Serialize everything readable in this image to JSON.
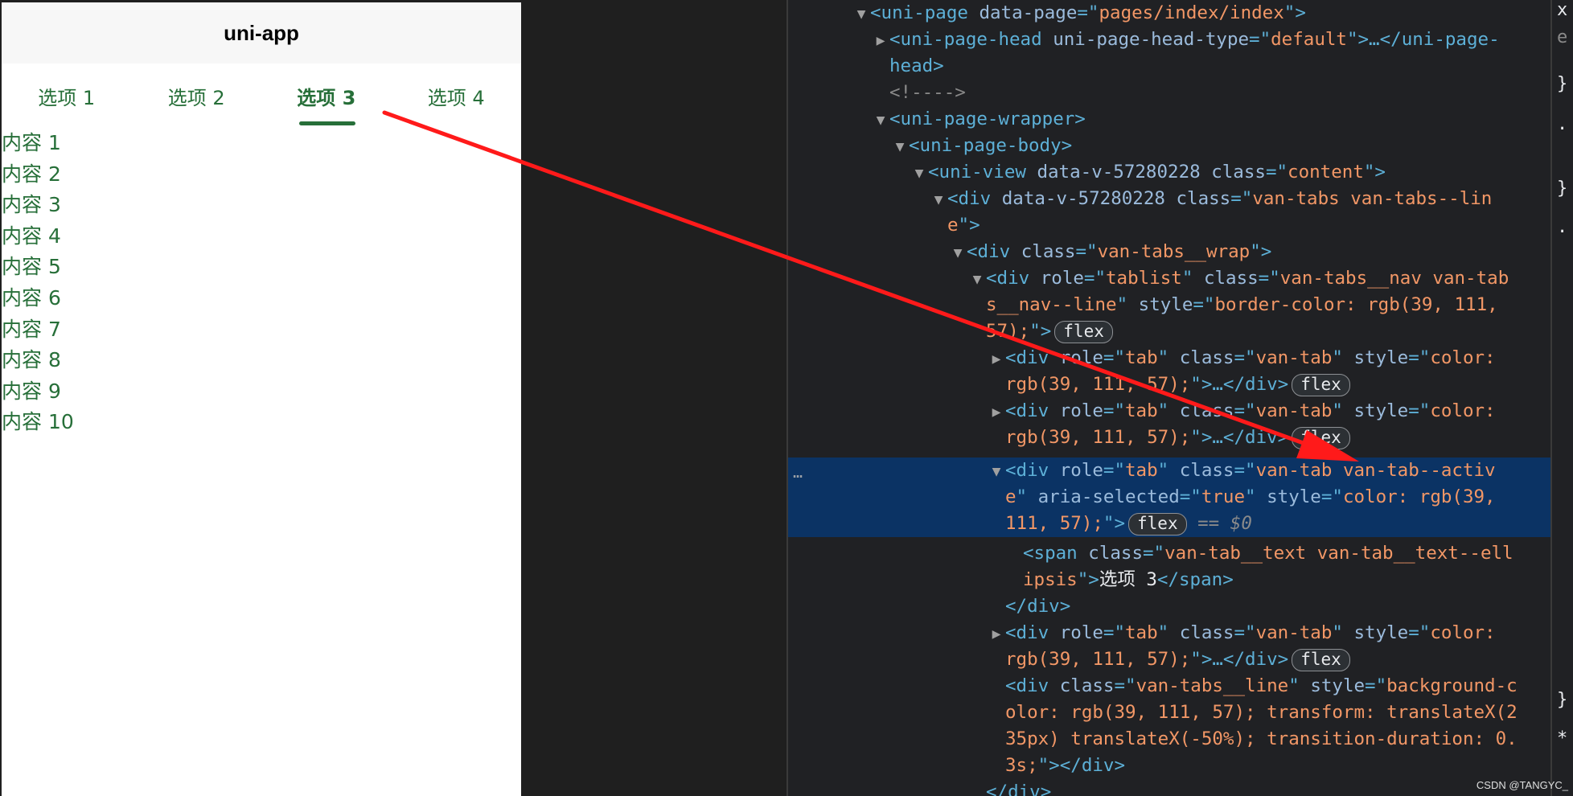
{
  "app": {
    "title": "uni-app"
  },
  "tabs": [
    {
      "label": "选项 1"
    },
    {
      "label": "选项 2"
    },
    {
      "label": "选项 3",
      "active": true
    },
    {
      "label": "选项 4"
    }
  ],
  "contents": [
    "内容 1",
    "内容 2",
    "内容 3",
    "内容 4",
    "内容 5",
    "内容 6",
    "内容 7",
    "内容 8",
    "内容 9",
    "内容 10"
  ],
  "colors": {
    "accent": "#276f39",
    "arrow": "#ff1a1a",
    "selection": "#0b3364"
  },
  "devtools": {
    "l1": {
      "tag_open": "<uni-page ",
      "attr": "data-page",
      "eq": "=\"",
      "val": "pages/index/index",
      "close": "\">"
    },
    "l2": {
      "tag_open": "<uni-page-head ",
      "attr": "uni-page-head-type",
      "eq": "=\"",
      "val": "default",
      "close": "\">…</uni-page-"
    },
    "l2b": {
      "text": "head>"
    },
    "l3": {
      "comment": "<!---->"
    },
    "l4": {
      "tag": "<uni-page-wrapper>"
    },
    "l5": {
      "tag": "<uni-page-body>"
    },
    "l6": {
      "tag_open": "<uni-view ",
      "attr1": "data-v-57280228 ",
      "attr2": "class",
      "eq": "=\"",
      "val": "content",
      "close": "\">"
    },
    "l7": {
      "tag_open": "<div ",
      "attr1": "data-v-57280228 ",
      "attr2": "class",
      "eq": "=\"",
      "val": "van-tabs van-tabs--lin"
    },
    "l7b": {
      "val": "e",
      "close": "\">"
    },
    "l8": {
      "tag_open": "<div ",
      "attr": "class",
      "eq": "=\"",
      "val": "van-tabs__wrap",
      "close": "\">"
    },
    "l9": {
      "tag_open": "<div ",
      "attr1": "role",
      "eq1": "=\"",
      "val1": "tablist",
      "q1": "\" ",
      "attr2": "class",
      "eq2": "=\"",
      "val2": "van-tabs__nav van-tab"
    },
    "l9b": {
      "val2": "s__nav--line",
      "q": "\" ",
      "attr3": "style",
      "eq": "=\"",
      "val3": "border-color: rgb(39, 111,"
    },
    "l9c": {
      "val3": "57);",
      "close": "\">",
      "badge": "flex"
    },
    "l10": {
      "tag_open": "<div ",
      "attr1": "role",
      "eq1": "=\"",
      "val1": "tab",
      "q1": "\" ",
      "attr2": "class",
      "eq2": "=\"",
      "val2": "van-tab",
      "q2": "\" ",
      "attr3": "style",
      "eq3": "=\"",
      "val3": "color:"
    },
    "l10b": {
      "val3": "rgb(39, 111, 57);",
      "close": "\">…</div>",
      "badge": "flex"
    },
    "l11": {
      "tag_open": "<div ",
      "attr1": "role",
      "eq1": "=\"",
      "val1": "tab",
      "q1": "\" ",
      "attr2": "class",
      "eq2": "=\"",
      "val2": "van-tab",
      "q2": "\" ",
      "attr3": "style",
      "eq3": "=\"",
      "val3": "color:"
    },
    "l11b": {
      "val3": "rgb(39, 111, 57);",
      "close": "\">…</div>",
      "badge": "flex"
    },
    "l12": {
      "tag_open": "<div ",
      "attr1": "role",
      "eq1": "=\"",
      "val1": "tab",
      "q1": "\" ",
      "attr2": "class",
      "eq2": "=\"",
      "val2": "van-tab van-tab--activ"
    },
    "l12b": {
      "val2": "e",
      "q": "\" ",
      "attr3": "aria-selected",
      "eq3": "=\"",
      "val3": "true",
      "q3": "\" ",
      "attr4": "style",
      "eq4": "=\"",
      "val4": "color: rgb(39,"
    },
    "l12c": {
      "val4": "111, 57);",
      "close": "\">",
      "badge": "flex",
      "ref": "== $0"
    },
    "l13": {
      "tag_open": "<span ",
      "attr": "class",
      "eq": "=\"",
      "val": "van-tab__text van-tab__text--ell"
    },
    "l13b": {
      "val": "ipsis",
      "close": "\">",
      "text": "选项 3",
      "end": "</span>"
    },
    "l14": {
      "tag": "</div>"
    },
    "l15": {
      "tag_open": "<div ",
      "attr1": "role",
      "eq1": "=\"",
      "val1": "tab",
      "q1": "\" ",
      "attr2": "class",
      "eq2": "=\"",
      "val2": "van-tab",
      "q2": "\" ",
      "attr3": "style",
      "eq3": "=\"",
      "val3": "color:"
    },
    "l15b": {
      "val3": "rgb(39, 111, 57);",
      "close": "\">…</div>",
      "badge": "flex"
    },
    "l16": {
      "tag_open": "<div ",
      "attr1": "class",
      "eq1": "=\"",
      "val1": "van-tabs__line",
      "q1": "\" ",
      "attr2": "style",
      "eq2": "=\"",
      "val2": "background-c"
    },
    "l16b": {
      "val2": "olor: rgb(39, 111, 57); transform: translateX(2"
    },
    "l16c": {
      "val2": "35px) translateX(-50%); transition-duration: 0."
    },
    "l16d": {
      "val2": "3s;",
      "close": "\"></div>"
    },
    "l17": {
      "tag": "</div>"
    },
    "dots": "…"
  },
  "styles_pane": [
    "x",
    "e",
    "}",
    ".",
    "}",
    ".",
    "}",
    "*"
  ],
  "watermark": "CSDN @TANGYC_"
}
